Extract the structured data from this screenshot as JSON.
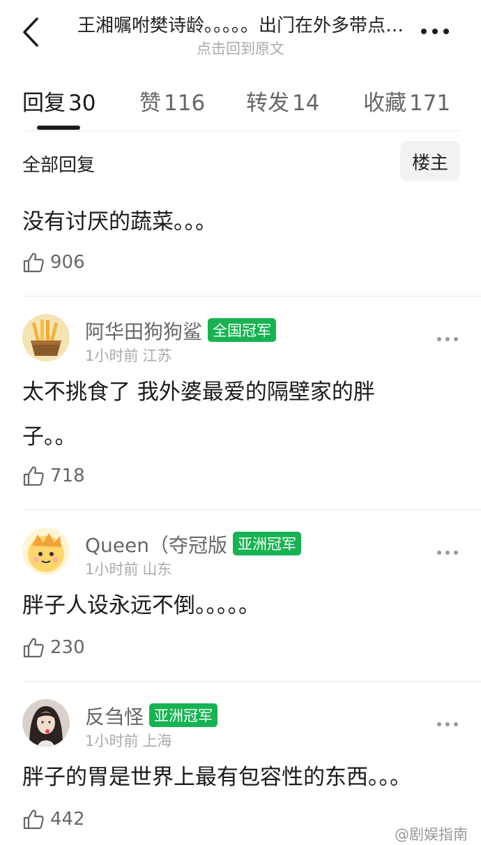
{
  "header": {
    "title": "王湘嘱咐樊诗龄。。。。。出门在外多带点…",
    "subtitle": "点击回到原文"
  },
  "tabs": [
    {
      "label": "回复",
      "count": "30"
    },
    {
      "label": "赞",
      "count": "116"
    },
    {
      "label": "转发",
      "count": "14"
    },
    {
      "label": "收藏",
      "count": "171"
    }
  ],
  "subheader": {
    "all_replies": "全部回复",
    "op_filter": "楼主"
  },
  "top_comment": {
    "text": "没有讨厌的蔬菜。。。",
    "likes": "906"
  },
  "comments": [
    {
      "username": "阿华田狗狗鲨",
      "badge": "全国冠军",
      "time": "1小时前",
      "location": "江苏",
      "text_line1": "太不挑食了 我外婆最爱的隔壁家的胖",
      "text_line2": "子。。",
      "likes": "718"
    },
    {
      "username": "Queen（夺冠版",
      "badge": "亚洲冠军",
      "time": "1小时前",
      "location": "山东",
      "text": "胖子人设永远不倒。。。。。",
      "likes": "230"
    },
    {
      "username": "反刍怪",
      "badge": "亚洲冠军",
      "time": "1小时前",
      "location": "上海",
      "text": "胖子的胃是世界上最有包容性的东西。。。",
      "likes": "442"
    }
  ],
  "watermark": "@剧娱指南",
  "colors": {
    "badge": "#17b352",
    "text": "#1a1a1a",
    "secondary": "#666666",
    "muted": "#aaaaaa"
  }
}
